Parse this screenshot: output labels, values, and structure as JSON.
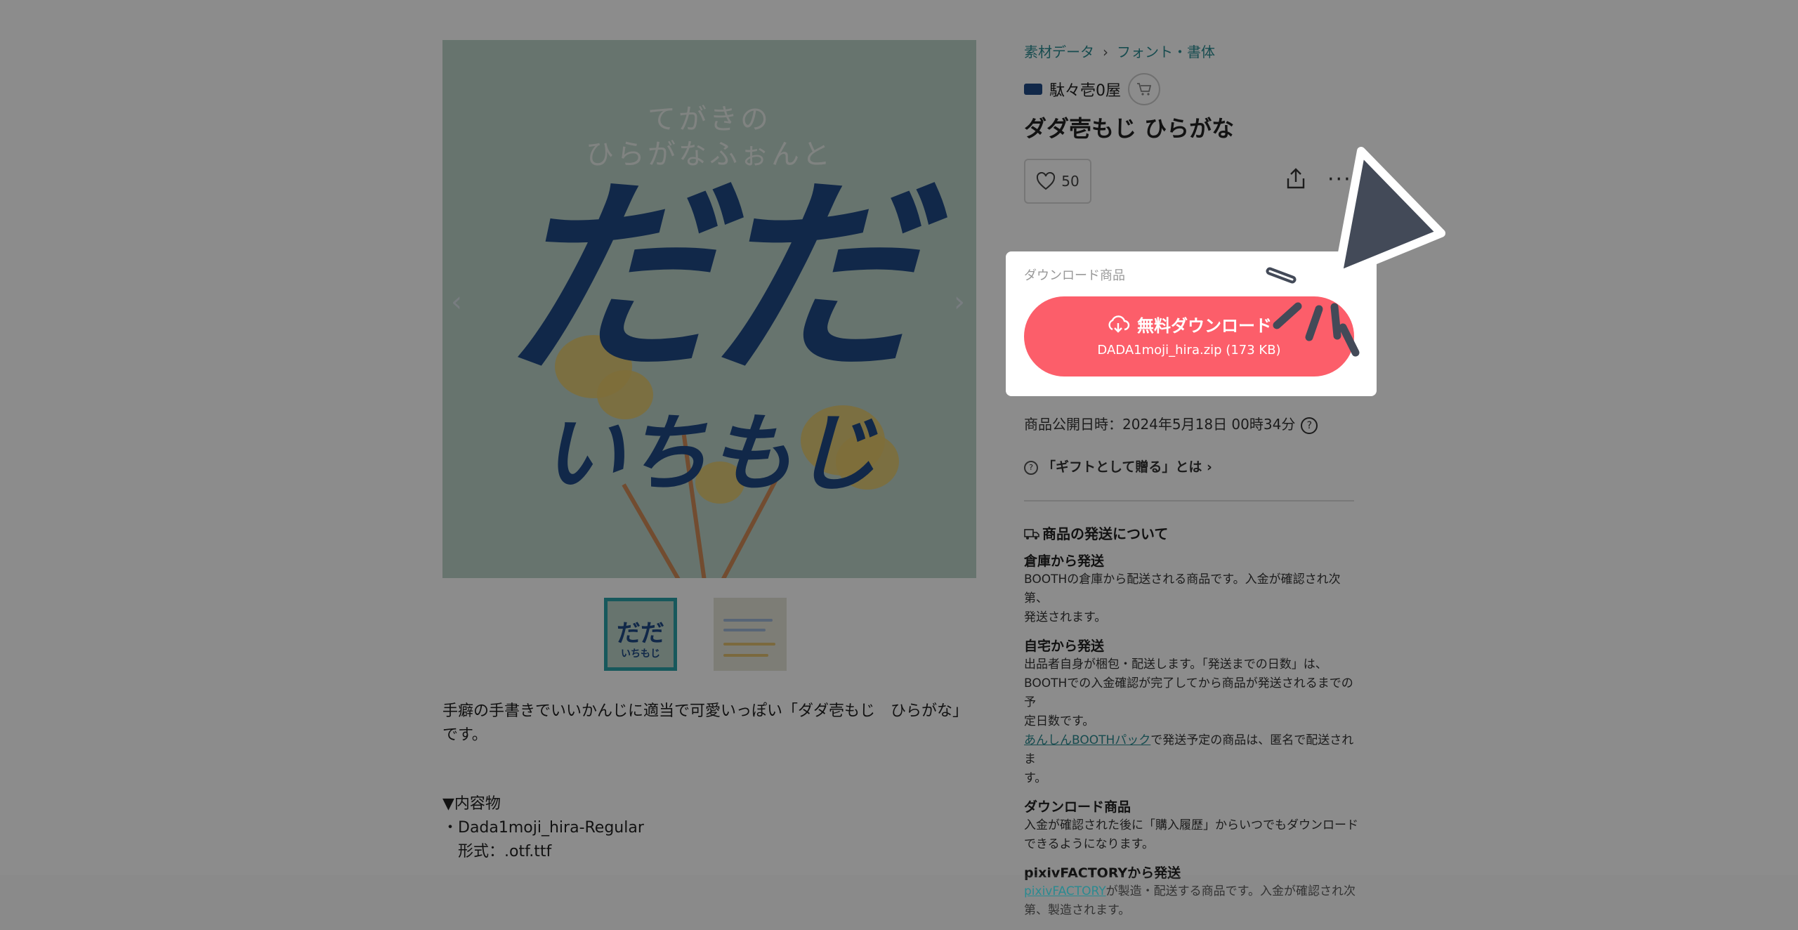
{
  "breadcrumb": {
    "item1": "素材データ",
    "separator": "›",
    "item2": "フォント・書体"
  },
  "shop": {
    "name": "駄々壱0屋",
    "cart_icon": "cart-icon"
  },
  "product": {
    "title": "ダダ壱もじ ひらがな",
    "likes": "50",
    "hero": {
      "subtitle_line1": "てがきの",
      "subtitle_line2": "ひらがなふぉんと",
      "big_line1": "だだ",
      "big_line2": "いちもじ",
      "prev": "‹",
      "next": "›"
    },
    "thumbs": {
      "first_top": "だだ",
      "first_bottom": "いちもじ"
    },
    "description_line1": "手癖の手書きでいいかんじに適当で可愛いっぽい「ダダ壱もじ　ひらがな」",
    "description_line2": "です。",
    "contents_header": "▼内容物",
    "contents_item": "・Dada1moji_hira-Regular",
    "contents_format": "　形式：.otf.ttf"
  },
  "download": {
    "label": "ダウンロード商品",
    "button_label": "無料ダウンロード",
    "file": "DADA1moji_hira.zip (173 KB)"
  },
  "published": {
    "text": "商品公開日時：2024年5月18日 00時34分",
    "help": "?"
  },
  "gift": {
    "icon": "?",
    "text": "「ギフトとして贈る」とは ›"
  },
  "shipping": {
    "heading": "商品の発送について",
    "warehouse_title": "倉庫から発送",
    "warehouse_body1": "BOOTHの倉庫から配送される商品です。入金が確認され次第、",
    "warehouse_body2": "発送されます。",
    "home_title": "自宅から発送",
    "home_body1": "出品者自身が梱包・配送します。「発送までの日数」は、",
    "home_body2": "BOOTHでの入金確認が完了してから商品が発送されるまでの予",
    "home_body3": "定日数です。",
    "home_link": "あんしんBOOTHパック",
    "home_body4": "で発送予定の商品は、匿名で配送されま",
    "home_body5": "す。",
    "download_title": "ダウンロード商品",
    "download_body1": "入金が確認された後に「購入履歴」からいつでもダウンロード",
    "download_body2": "できるようになります。",
    "factory_title": "pixivFACTORYから発送",
    "factory_link": "pixivFACTORY",
    "factory_body1": "が製造・配送する商品です。入金が確認され次",
    "factory_body2": "第、製造されます。"
  },
  "icons": {
    "like": "heart-icon",
    "share": "share-icon",
    "more": "more-icon",
    "download": "cloud-download-icon",
    "pointer": "cursor-icon"
  },
  "colors": {
    "accent": "#fc5e6a",
    "link": "#2a8a91",
    "overlay": "#000000"
  }
}
